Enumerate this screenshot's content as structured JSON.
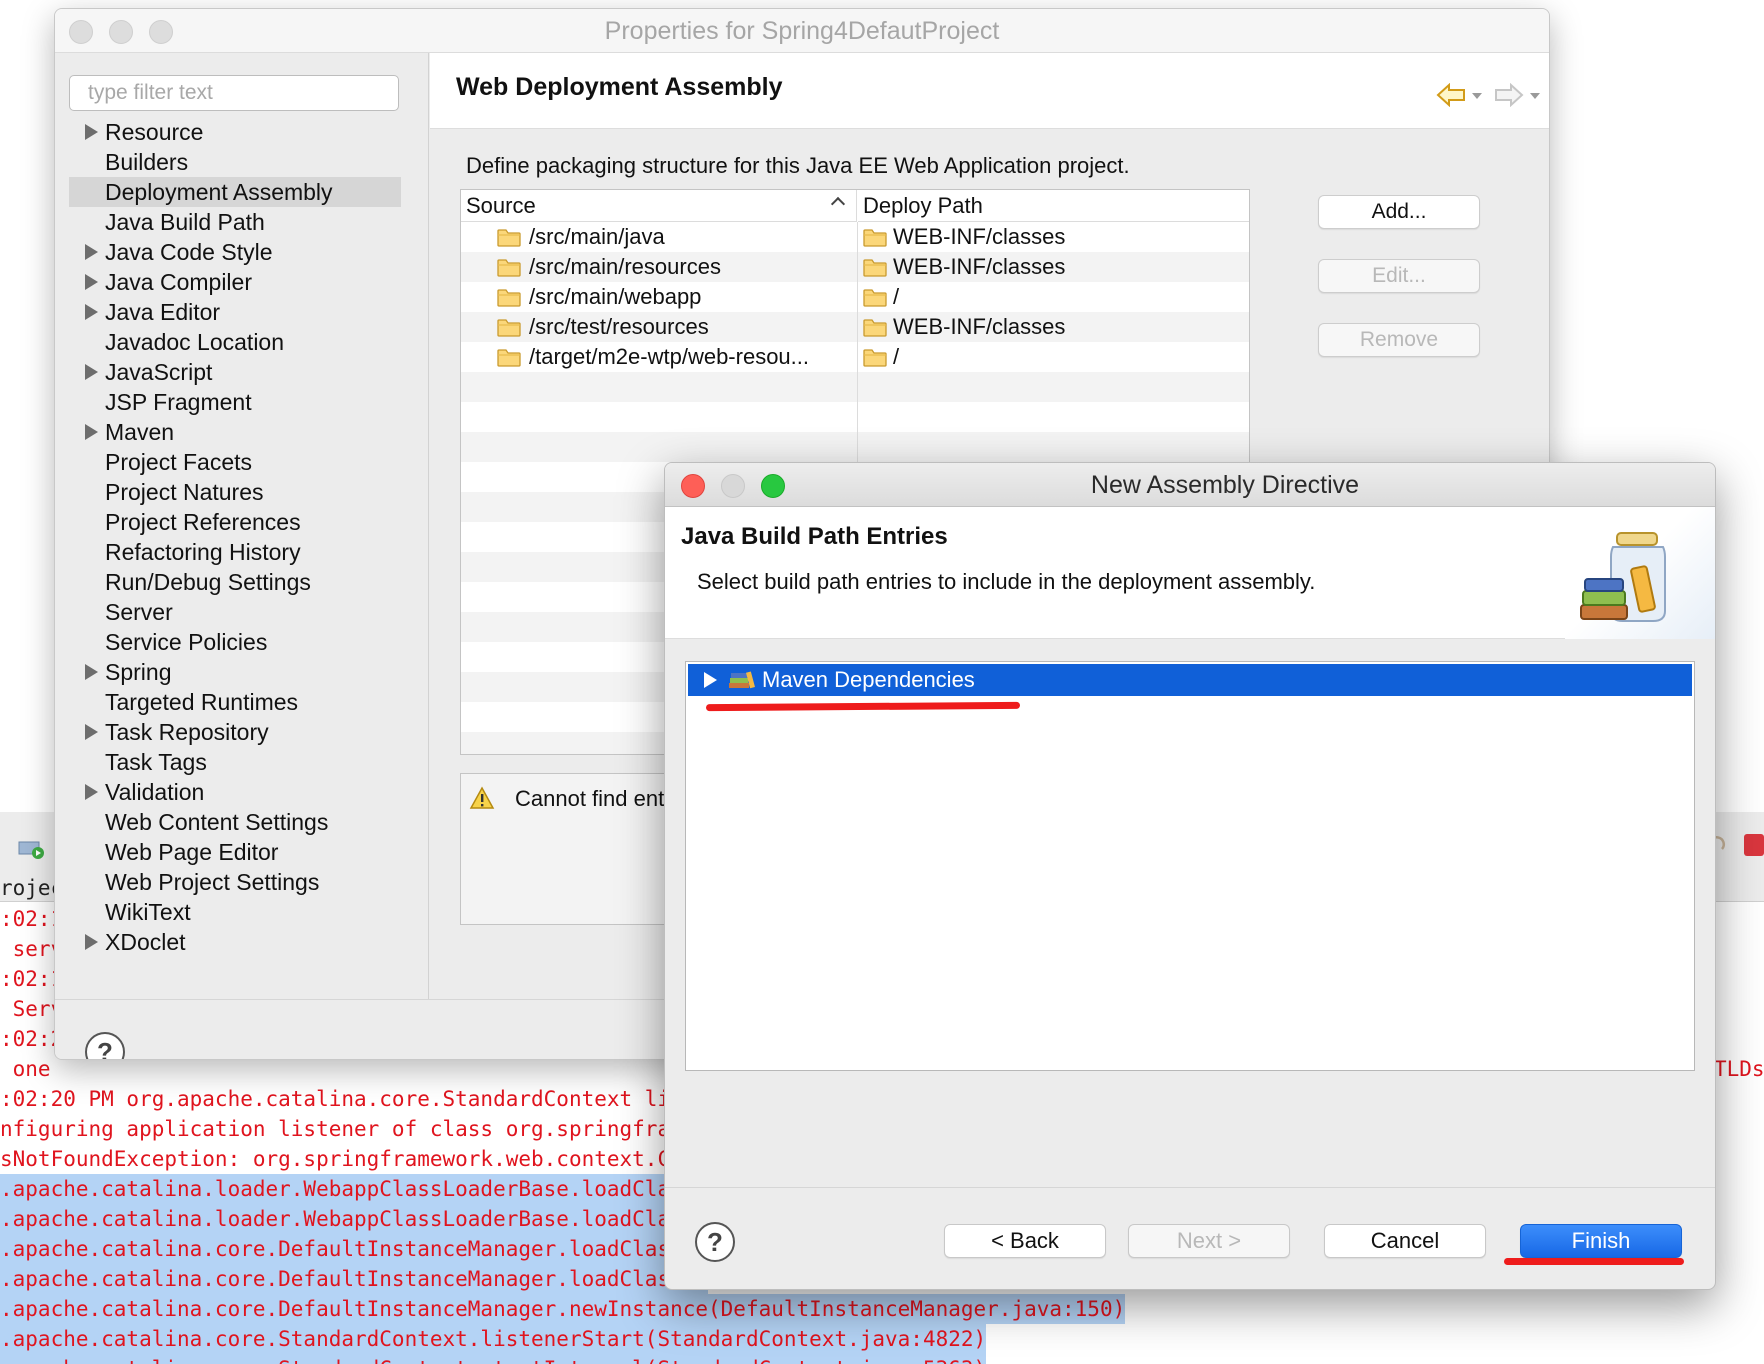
{
  "ide": {
    "tab_label": "rojec",
    "console_lines": [
      {
        "text": ":02:1",
        "selected": false
      },
      {
        "text": " serv",
        "selected": false
      },
      {
        "text": ":02:1",
        "selected": false
      },
      {
        "text": " Serv",
        "selected": false
      },
      {
        "text": ":02:2",
        "selected": false
      },
      {
        "text": " one ",
        "selected": false
      },
      {
        "text": ":02:20 PM org.apache.catalina.core.StandardContext liste",
        "selected": false
      },
      {
        "text": "nfiguring application listener of class org.springframew",
        "selected": false
      },
      {
        "text": "sNotFoundException: org.springframework.web.context.Cont",
        "selected": false
      },
      {
        "text": ".apache.catalina.loader.WebappClassLoaderBase.loadClass(",
        "selected": true
      },
      {
        "text": ".apache.catalina.loader.WebappClassLoaderBase.loadClass(",
        "selected": true
      },
      {
        "text": ".apache.catalina.core.DefaultInstanceManager.loadClass(D",
        "selected": true
      },
      {
        "text": ".apache.catalina.core.DefaultInstanceManager.loadClassMa",
        "selected": true
      },
      {
        "text": ".apache.catalina.core.DefaultInstanceManager.newInstance(DefaultInstanceManager.java:150)",
        "selected": true
      },
      {
        "text": ".apache.catalina.core.StandardContext.listenerStart(StandardContext.java:4822)",
        "selected": true
      },
      {
        "text": ".apache.catalina.core.StandardContext.startInternal(StandardContext.java:5363)",
        "selected": true
      }
    ],
    "tlds_text": "TLDs"
  },
  "properties": {
    "window_title": "Properties for Spring4DefautProject",
    "filter_placeholder": "type filter text",
    "tree": [
      {
        "label": "Resource",
        "expandable": true
      },
      {
        "label": "Builders",
        "expandable": false
      },
      {
        "label": "Deployment Assembly",
        "expandable": false,
        "selected": true
      },
      {
        "label": "Java Build Path",
        "expandable": false
      },
      {
        "label": "Java Code Style",
        "expandable": true
      },
      {
        "label": "Java Compiler",
        "expandable": true
      },
      {
        "label": "Java Editor",
        "expandable": true
      },
      {
        "label": "Javadoc Location",
        "expandable": false
      },
      {
        "label": "JavaScript",
        "expandable": true
      },
      {
        "label": "JSP Fragment",
        "expandable": false
      },
      {
        "label": "Maven",
        "expandable": true
      },
      {
        "label": "Project Facets",
        "expandable": false
      },
      {
        "label": "Project Natures",
        "expandable": false
      },
      {
        "label": "Project References",
        "expandable": false
      },
      {
        "label": "Refactoring History",
        "expandable": false
      },
      {
        "label": "Run/Debug Settings",
        "expandable": false
      },
      {
        "label": "Server",
        "expandable": false
      },
      {
        "label": "Service Policies",
        "expandable": false
      },
      {
        "label": "Spring",
        "expandable": true
      },
      {
        "label": "Targeted Runtimes",
        "expandable": false
      },
      {
        "label": "Task Repository",
        "expandable": true
      },
      {
        "label": "Task Tags",
        "expandable": false
      },
      {
        "label": "Validation",
        "expandable": true
      },
      {
        "label": "Web Content Settings",
        "expandable": false
      },
      {
        "label": "Web Page Editor",
        "expandable": false
      },
      {
        "label": "Web Project Settings",
        "expandable": false
      },
      {
        "label": "WikiText",
        "expandable": false
      },
      {
        "label": "XDoclet",
        "expandable": true
      }
    ],
    "page_title": "Web Deployment Assembly",
    "description": "Define packaging structure for this Java EE Web Application project.",
    "table": {
      "col_source": "Source",
      "col_deploy": "Deploy Path",
      "rows": [
        {
          "source": "/src/main/java",
          "deploy": "WEB-INF/classes"
        },
        {
          "source": "/src/main/resources",
          "deploy": "WEB-INF/classes"
        },
        {
          "source": "/src/main/webapp",
          "deploy": "/"
        },
        {
          "source": "/src/test/resources",
          "deploy": "WEB-INF/classes"
        },
        {
          "source": "/target/m2e-wtp/web-resou...",
          "deploy": "/"
        }
      ]
    },
    "buttons": {
      "add": "Add...",
      "edit": "Edit...",
      "remove": "Remove"
    },
    "message": "Cannot find ent",
    "help_label": "?"
  },
  "dialog": {
    "title": "New Assembly Directive",
    "banner_title": "Java Build Path Entries",
    "banner_desc": "Select build path entries to include in the deployment assembly.",
    "list_items": [
      {
        "label": "Maven Dependencies",
        "selected": true
      }
    ],
    "buttons": {
      "back": "< Back",
      "next": "Next >",
      "cancel": "Cancel",
      "finish": "Finish"
    },
    "help_label": "?"
  },
  "colors": {
    "selection_blue": "#1060d8",
    "finish_blue": "#1768e6",
    "annotation_red": "#ee1c1c",
    "console_red": "#e0141e"
  }
}
